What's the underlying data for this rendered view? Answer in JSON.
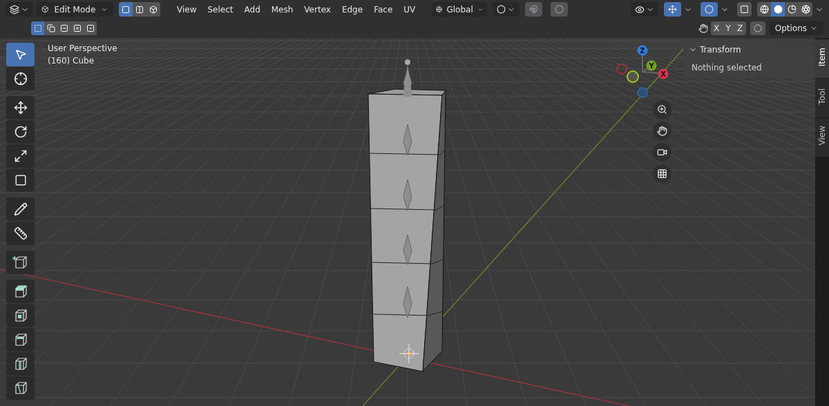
{
  "header": {
    "mode": "Edit Mode",
    "select_modes": [
      {
        "kind": "vertex",
        "selected": true
      },
      {
        "kind": "edge",
        "selected": false
      },
      {
        "kind": "face",
        "selected": false
      }
    ],
    "menus": [
      "View",
      "Select",
      "Add",
      "Mesh",
      "Vertex",
      "Edge",
      "Face",
      "UV"
    ],
    "orientation": "Global",
    "snap": {
      "on": false
    },
    "proportional_edit": {
      "on": false
    },
    "gizmos": {
      "on": true
    },
    "overlays": {
      "on": true
    },
    "xray": {
      "on": false
    },
    "shading": [
      {
        "kind": "wireframe",
        "selected": false
      },
      {
        "kind": "solid",
        "selected": true
      },
      {
        "kind": "material",
        "selected": false
      },
      {
        "kind": "rendered",
        "selected": false
      }
    ]
  },
  "subheader": {
    "select_box_modes": [
      {
        "kind": "set",
        "selected": true
      },
      {
        "kind": "extend",
        "selected": false
      },
      {
        "kind": "subtract",
        "selected": false
      },
      {
        "kind": "invert",
        "selected": false
      },
      {
        "kind": "intersect",
        "selected": false
      }
    ],
    "mirror_axes": [
      {
        "label": "X",
        "on": false
      },
      {
        "label": "Y",
        "on": false
      },
      {
        "label": "Z",
        "on": false
      }
    ],
    "options": "Options"
  },
  "viewport": {
    "view_name": "User Perspective",
    "object_label": "(160) Cube"
  },
  "tool_groups": [
    {
      "tools": [
        {
          "kind": "select",
          "selected": true
        },
        {
          "kind": "cursor",
          "selected": false
        }
      ]
    },
    {
      "tools": [
        {
          "kind": "move",
          "selected": false
        },
        {
          "kind": "rotate",
          "selected": false
        },
        {
          "kind": "scale",
          "selected": false
        },
        {
          "kind": "transform",
          "selected": false
        }
      ]
    },
    {
      "tools": [
        {
          "kind": "annotate",
          "selected": false
        },
        {
          "kind": "measure",
          "selected": false
        }
      ]
    },
    {
      "tools": [
        {
          "kind": "add_cube",
          "selected": false
        }
      ]
    },
    {
      "tools": [
        {
          "kind": "extrude",
          "selected": false
        },
        {
          "kind": "inset",
          "selected": false
        },
        {
          "kind": "bevel",
          "selected": false
        },
        {
          "kind": "loop_cut",
          "selected": false
        },
        {
          "kind": "knife",
          "selected": false
        }
      ]
    }
  ],
  "gizmo_axes": [
    {
      "label": "Z",
      "color": "#2f7fe0"
    },
    {
      "label": "Y",
      "color": "#74a21b"
    },
    {
      "label": "X",
      "color": "#e0304f"
    }
  ],
  "panel": {
    "title": "Transform",
    "expanded": true,
    "message": "Nothing selected"
  },
  "sidebar_tabs": [
    {
      "label": "Item",
      "selected": true
    },
    {
      "label": "Tool",
      "selected": false
    },
    {
      "label": "View",
      "selected": false
    }
  ]
}
